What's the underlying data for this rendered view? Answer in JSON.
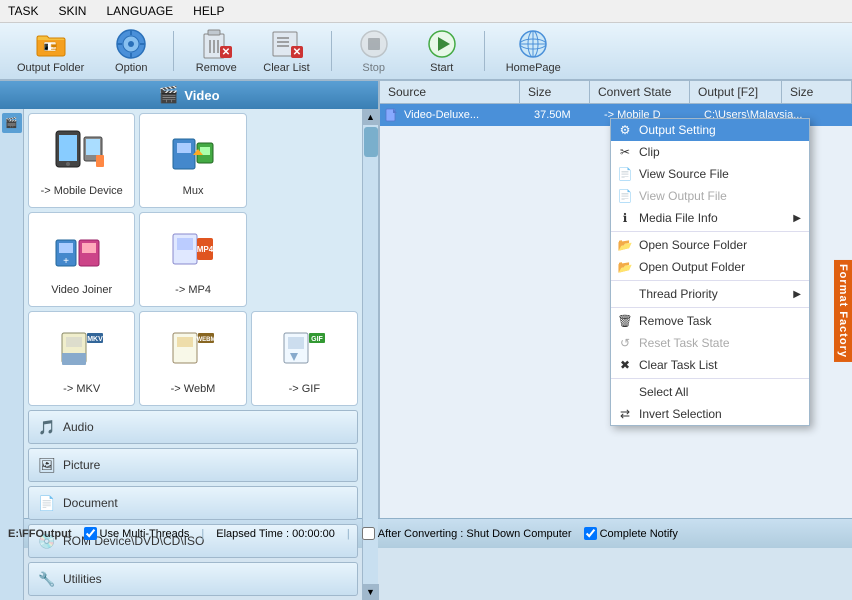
{
  "menubar": {
    "items": [
      "TASK",
      "SKIN",
      "LANGUAGE",
      "HELP"
    ]
  },
  "toolbar": {
    "buttons": [
      {
        "id": "output-folder",
        "label": "Output Folder",
        "icon": "📁"
      },
      {
        "id": "option",
        "label": "Option",
        "icon": "⚙"
      },
      {
        "id": "remove",
        "label": "Remove",
        "icon": "🗑"
      },
      {
        "id": "clear-list",
        "label": "Clear List",
        "icon": "✖"
      },
      {
        "id": "stop",
        "label": "Stop",
        "icon": "⏹"
      },
      {
        "id": "start",
        "label": "Start",
        "icon": "▶"
      },
      {
        "id": "homepage",
        "label": "HomePage",
        "icon": "🌐"
      }
    ]
  },
  "left_panel": {
    "header": "Video",
    "grid_items": [
      {
        "label": "-> Mobile Device",
        "icon": "📱"
      },
      {
        "label": "Mux",
        "icon": "🎬"
      },
      {
        "label": "Video Joiner",
        "icon": "🎞"
      },
      {
        "label": "-> MP4",
        "icon": "📹"
      },
      {
        "label": "-> MKV",
        "icon": "🎥"
      },
      {
        "label": "-> WebM",
        "icon": "📺"
      },
      {
        "label": "-> GIF",
        "icon": "🖼"
      }
    ],
    "categories": [
      {
        "label": "Audio",
        "icon": "🎵"
      },
      {
        "label": "Picture",
        "icon": "🖼"
      },
      {
        "label": "Document",
        "icon": "📄"
      },
      {
        "label": "ROM Device\\DVD\\CD\\ISO",
        "icon": "💿"
      },
      {
        "label": "Utilities",
        "icon": "🔧"
      }
    ]
  },
  "right_panel": {
    "columns": [
      "Source",
      "Size",
      "Convert State",
      "Output [F2]",
      "Size"
    ],
    "rows": [
      {
        "source": "Video-Deluxe...",
        "size": "37.50M",
        "convert": "-> Mobile D",
        "output": "C:\\Users\\Malaysia...",
        "output_size": ""
      }
    ]
  },
  "context_menu": {
    "items": [
      {
        "id": "output-setting",
        "label": "Output Setting",
        "icon": "⚙",
        "disabled": false,
        "highlighted": true,
        "separator_after": false
      },
      {
        "id": "clip",
        "label": "Clip",
        "icon": "✂",
        "disabled": false,
        "highlighted": false,
        "separator_after": false
      },
      {
        "id": "view-source-file",
        "label": "View Source File",
        "icon": "📄",
        "disabled": false,
        "highlighted": false,
        "separator_after": false
      },
      {
        "id": "view-output-file",
        "label": "View Output File",
        "icon": "📄",
        "disabled": true,
        "highlighted": false,
        "separator_after": false
      },
      {
        "id": "media-file-info",
        "label": "Media File Info",
        "icon": "ℹ",
        "disabled": false,
        "highlighted": false,
        "has_arrow": true,
        "separator_after": true
      },
      {
        "id": "open-source-folder",
        "label": "Open Source Folder",
        "icon": "📂",
        "disabled": false,
        "highlighted": false,
        "separator_after": false
      },
      {
        "id": "open-output-folder",
        "label": "Open Output Folder",
        "icon": "📂",
        "disabled": false,
        "highlighted": false,
        "separator_after": true
      },
      {
        "id": "thread-priority",
        "label": "Thread Priority",
        "icon": "",
        "disabled": false,
        "highlighted": false,
        "has_arrow": true,
        "separator_after": true
      },
      {
        "id": "remove-task",
        "label": "Remove Task",
        "icon": "🗑",
        "disabled": false,
        "highlighted": false,
        "separator_after": false
      },
      {
        "id": "reset-task-state",
        "label": "Reset Task State",
        "icon": "↺",
        "disabled": true,
        "highlighted": false,
        "separator_after": false
      },
      {
        "id": "clear-task-list",
        "label": "Clear Task List",
        "icon": "✖",
        "disabled": false,
        "highlighted": false,
        "separator_after": true
      },
      {
        "id": "select-all",
        "label": "Select All",
        "icon": "",
        "disabled": false,
        "highlighted": false,
        "separator_after": false
      },
      {
        "id": "invert-selection",
        "label": "Invert Selection",
        "icon": "⇄",
        "disabled": false,
        "highlighted": false,
        "separator_after": false
      }
    ]
  },
  "statusbar": {
    "output_path": "E:\\FFOutput",
    "checkboxes": [
      {
        "label": "Use Multi-Threads",
        "checked": true
      },
      {
        "label": "After Converting : Shut Down Computer",
        "checked": false
      },
      {
        "label": "Complete Notify",
        "checked": true
      }
    ],
    "elapsed": "Elapsed Time : 00:00:00"
  },
  "format_factory_label": "Format Factory"
}
